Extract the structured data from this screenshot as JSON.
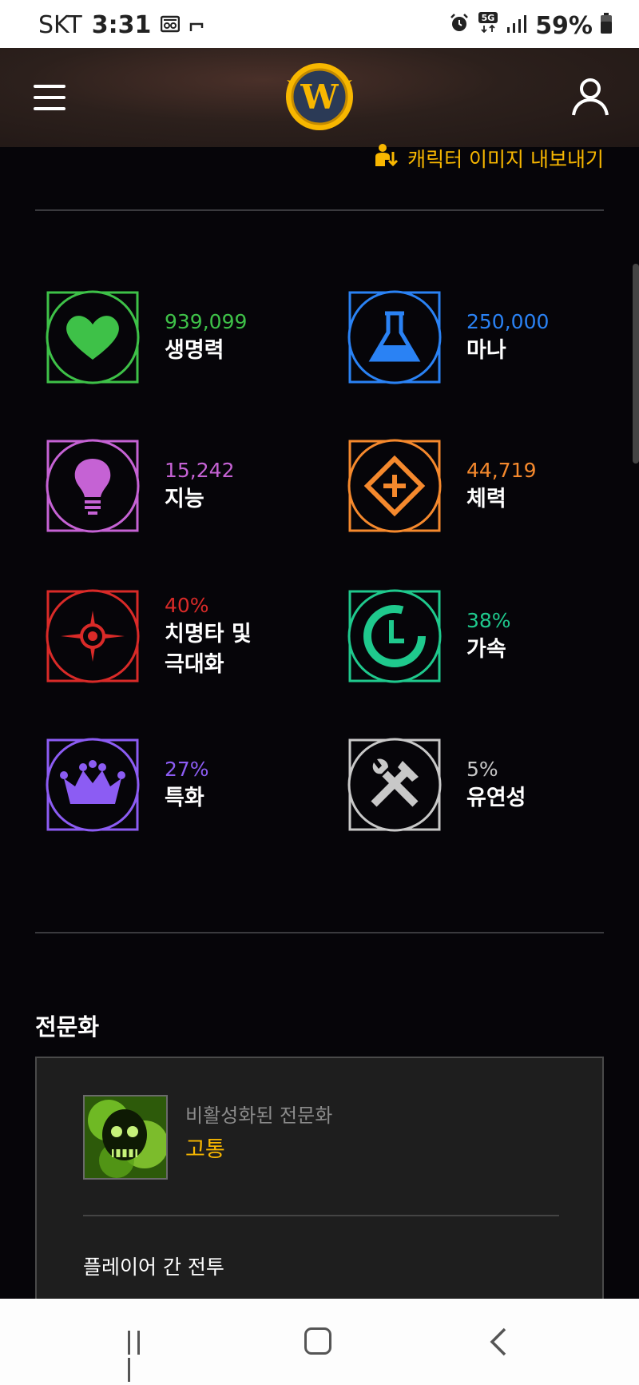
{
  "status_bar": {
    "carrier": "SKT",
    "time": "3:31",
    "battery": "59%",
    "network": "5G"
  },
  "header": {
    "menu_icon": "hamburger-menu-icon",
    "logo_letter": "W",
    "account_icon": "user-icon"
  },
  "export_link": {
    "label": "캐릭터 이미지 내보내기",
    "color": "#f8b700"
  },
  "stats": [
    {
      "value": "939,099",
      "label": "생명력",
      "color": "#3ec148",
      "icon": "heart-icon"
    },
    {
      "value": "250,000",
      "label": "마나",
      "color": "#2a82f4",
      "icon": "flask-icon"
    },
    {
      "value": "15,242",
      "label": "지능",
      "color": "#c562d4",
      "icon": "lightbulb-icon"
    },
    {
      "value": "44,719",
      "label": "체력",
      "color": "#f5892d",
      "icon": "diamond-plus-icon"
    },
    {
      "value": "40%",
      "label": "치명타 및 극대화",
      "label_line1": "치명타 및",
      "label_line2": "극대화",
      "color": "#d92a28",
      "icon": "crosshair-icon"
    },
    {
      "value": "38%",
      "label": "가속",
      "color": "#1fc98d",
      "icon": "clock-icon"
    },
    {
      "value": "27%",
      "label": "특화",
      "color": "#8c5cf3",
      "icon": "crown-icon"
    },
    {
      "value": "5%",
      "label": "유연성",
      "color": "#c8c8c8",
      "icon": "tools-icon"
    }
  ],
  "specialization": {
    "title": "전문화",
    "inactive_label": "비활성화된 전문화",
    "spec_name": "고통",
    "pvp_label": "플레이어 간 전투"
  }
}
